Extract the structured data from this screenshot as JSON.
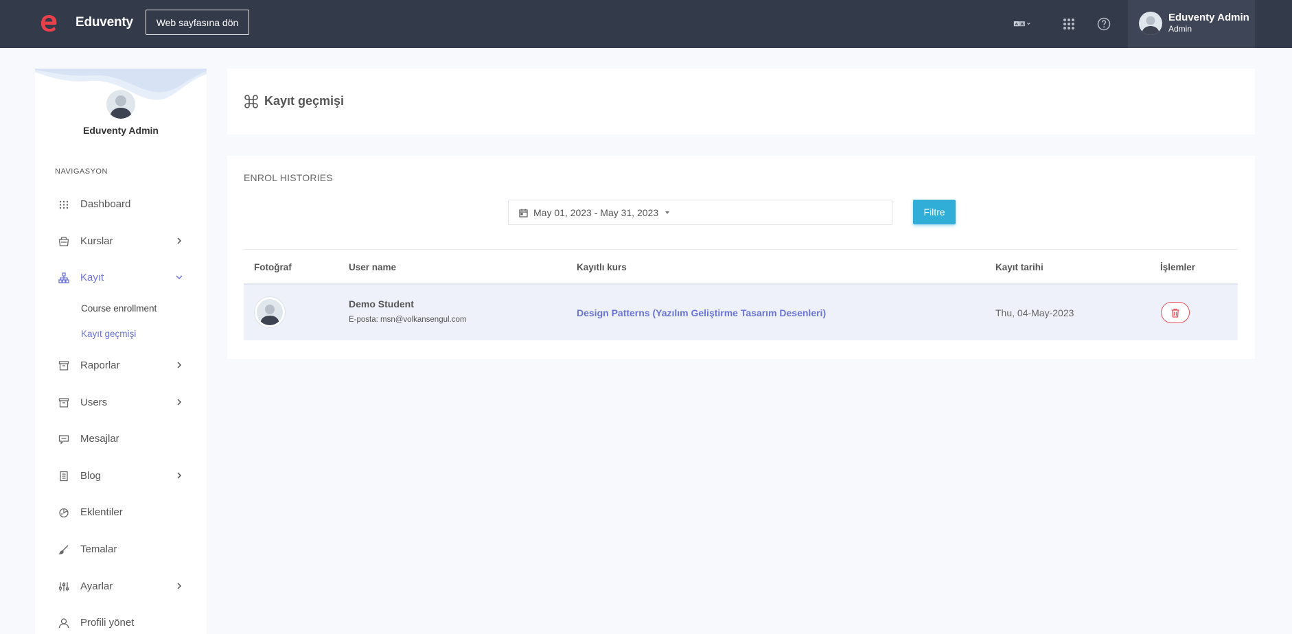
{
  "topbar": {
    "brand": "Eduventy",
    "back_button": "Web sayfasına dön",
    "icons": [
      "translate-icon",
      "apps-grid-icon",
      "help-icon"
    ],
    "user": {
      "name": "Eduventy Admin",
      "role": "Admin"
    }
  },
  "sidebar": {
    "user_name": "Eduventy Admin",
    "nav_heading": "NAVIGASYON",
    "items": [
      {
        "label": "Dashboard",
        "icon": "dashboard-grid-icon"
      },
      {
        "label": "Kurslar",
        "icon": "courses-icon"
      },
      {
        "label": "Kayıt",
        "icon": "enrollment-icon"
      },
      {
        "label": "Raporlar",
        "icon": "reports-icon"
      },
      {
        "label": "Users",
        "icon": "users-icon"
      },
      {
        "label": "Mesajlar",
        "icon": "messages-icon"
      },
      {
        "label": "Blog",
        "icon": "blog-icon"
      },
      {
        "label": "Eklentiler",
        "icon": "addons-icon"
      },
      {
        "label": "Temalar",
        "icon": "themes-icon"
      },
      {
        "label": "Ayarlar",
        "icon": "settings-icon"
      },
      {
        "label": "Profili yönet",
        "icon": "profile-icon"
      }
    ],
    "sub_items": [
      {
        "label": "Course enrollment"
      },
      {
        "label": "Kayıt geçmişi"
      }
    ]
  },
  "page": {
    "title": "Kayıt geçmişi",
    "section_title": "ENROL HISTORIES",
    "date_range": "May 01, 2023 - May 31, 2023",
    "filter_button": "Filtre"
  },
  "table": {
    "headers": [
      "Fotoğraf",
      "User name",
      "Kayıtlı kurs",
      "Kayıt tarihi",
      "İşlemler"
    ],
    "rows": [
      {
        "name": "Demo Student",
        "email": "E-posta: msn@volkansengul.com",
        "course": "Design Patterns (Yazılım Geliştirme Tasarım Desenleri)",
        "date": "Thu, 04-May-2023"
      }
    ]
  },
  "colors": {
    "topbar": "#333a4a",
    "accent": "#6a73d8",
    "filter": "#31aed8",
    "danger": "#e8505b"
  }
}
